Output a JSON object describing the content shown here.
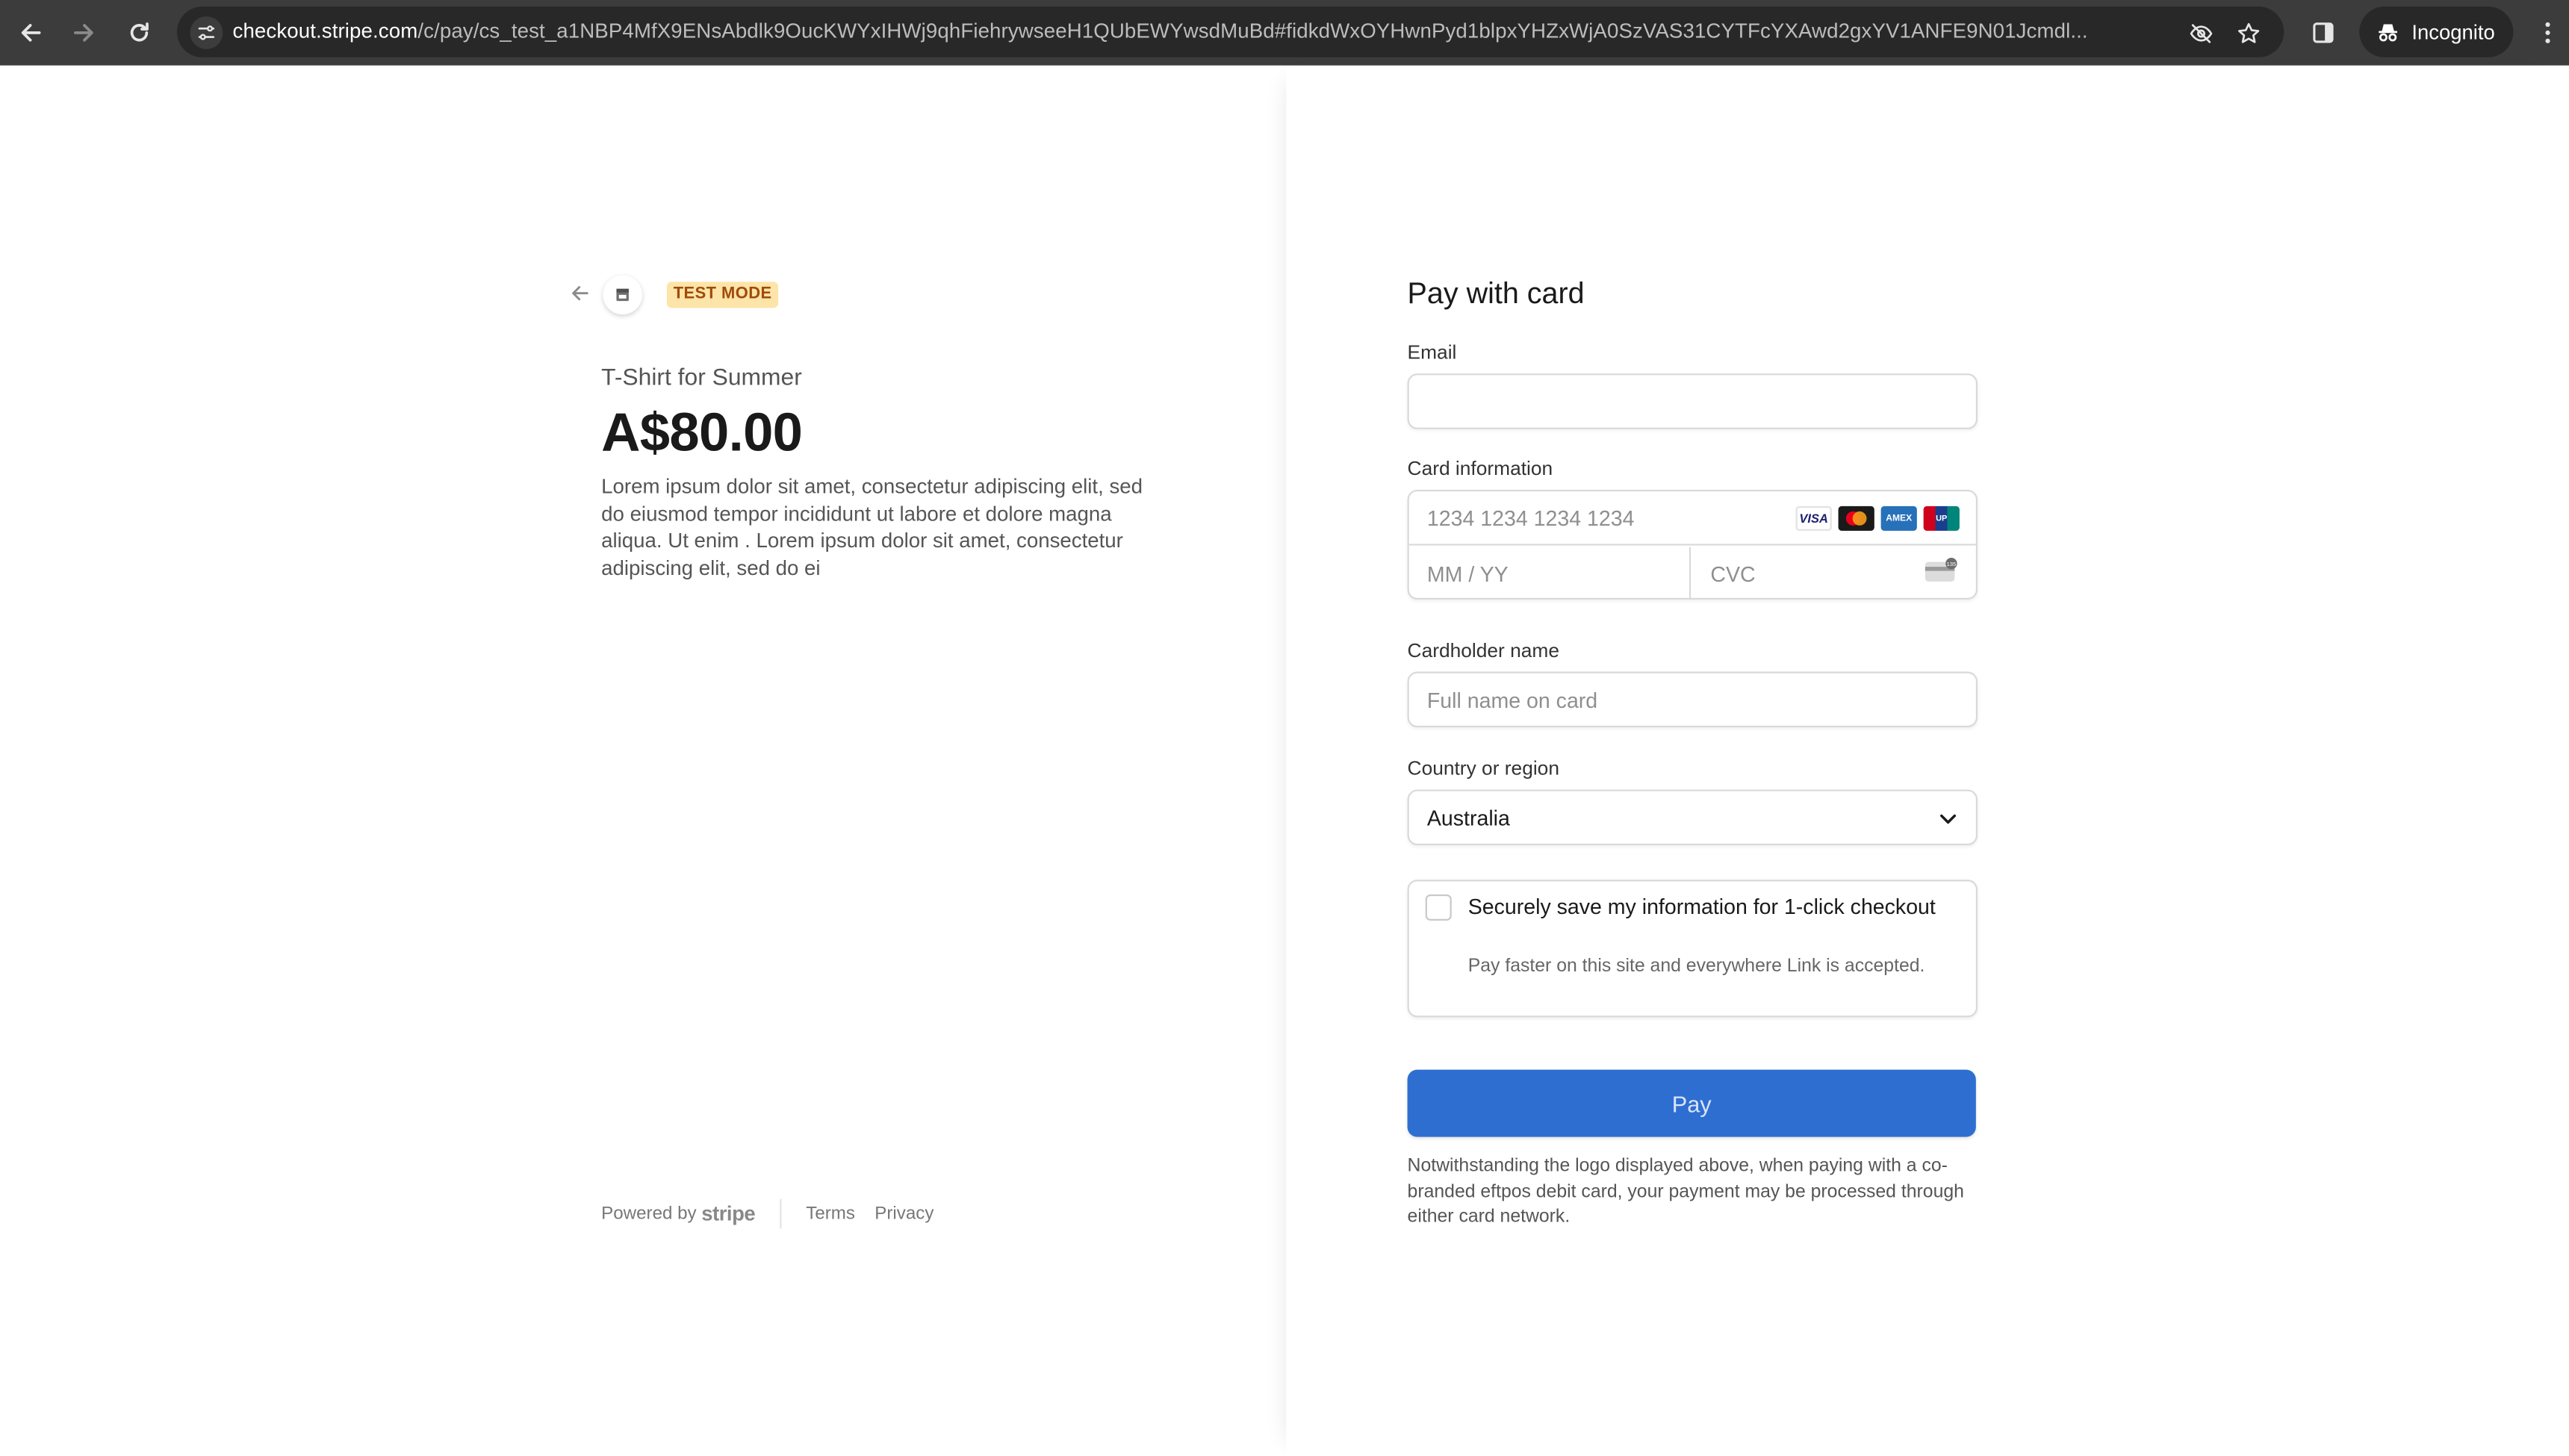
{
  "browser": {
    "url_host": "checkout.stripe.com",
    "url_path": "/c/pay/cs_test_a1NBP4MfX9ENsAbdlk9OucKWYxIHWj9qhFiehrywseeH1QUbEWYwsdMuBd#fidkdWxOYHwnPyd1blpxYHZxWjA0SzVAS31CYTFcYXAwd2gxYV1ANFE9N01Jcmdl...",
    "incognito_label": "Incognito"
  },
  "merchant": {
    "badge": "TEST MODE"
  },
  "product": {
    "name": "T-Shirt for Summer",
    "price": "A$80.00",
    "description": "Lorem ipsum dolor sit amet, consectetur adipiscing elit, sed do eiusmod tempor incididunt ut labore et dolore magna aliqua. Ut enim . Lorem ipsum dolor sit amet, consectetur adipiscing elit, sed do ei"
  },
  "footer": {
    "powered_by": "Powered by",
    "brand": "stripe",
    "terms": "Terms",
    "privacy": "Privacy"
  },
  "form": {
    "title": "Pay with card",
    "email_label": "Email",
    "email_value": "",
    "card_label": "Card information",
    "card_number_placeholder": "1234 1234 1234 1234",
    "expiry_placeholder": "MM / YY",
    "cvc_placeholder": "CVC",
    "brands": [
      "VISA",
      "MC",
      "AMEX",
      "UP"
    ],
    "cardholder_label": "Cardholder name",
    "cardholder_placeholder": "Full name on card",
    "country_label": "Country or region",
    "country_value": "Australia",
    "save_title": "Securely save my information for 1-click checkout",
    "save_subtitle": "Pay faster on this site and everywhere Link is accepted.",
    "save_checked": false,
    "pay_label": "Pay",
    "disclaimer": "Notwithstanding the logo displayed above, when paying with a co-branded eftpos debit card, your payment may be processed through either card network."
  },
  "colors": {
    "pay_button": "#2e6ed1",
    "badge_bg": "#fde4a8",
    "badge_text": "#a04b0a",
    "chrome_bg": "#3c3c3c"
  },
  "icons": {
    "back": "arrow-left-icon",
    "forward": "arrow-right-icon",
    "reload": "reload-icon",
    "site_settings": "tune-icon",
    "eye_off": "eye-off-icon",
    "star": "star-icon",
    "side_panel": "side-panel-icon",
    "menu": "more-vert-icon",
    "store": "store-icon",
    "chevron": "chevron-down-icon"
  }
}
